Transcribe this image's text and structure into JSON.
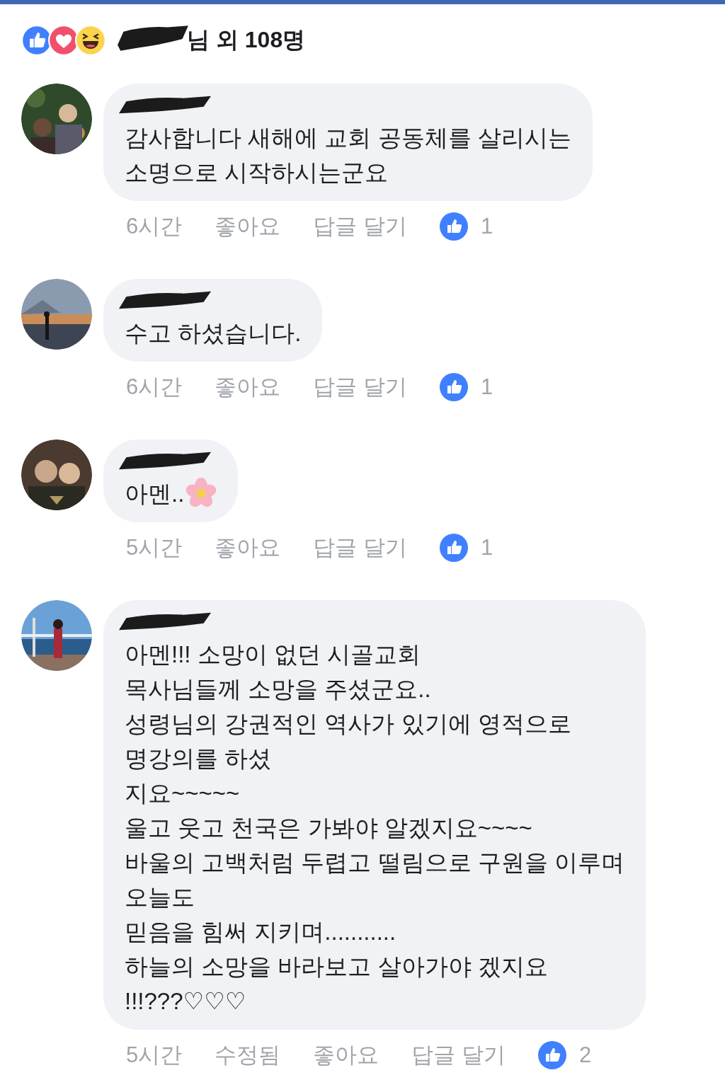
{
  "reactions": {
    "icons": [
      {
        "kind": "like"
      },
      {
        "kind": "love"
      },
      {
        "kind": "haha"
      }
    ],
    "name_redacted": true,
    "summary": "님 외 108명"
  },
  "comments": [
    {
      "name_redacted": true,
      "lines": [
        "감사합니다 새해에 교회 공동체를 살리시는",
        "소명으로 시작하시는군요"
      ],
      "meta": [
        "6시간",
        "좋아요",
        "답글 달기"
      ],
      "like_count": "1"
    },
    {
      "name_redacted": true,
      "lines": [
        "수고 하셨습니다."
      ],
      "meta": [
        "6시간",
        "좋아요",
        "답글 달기"
      ],
      "like_count": "1"
    },
    {
      "name_redacted": true,
      "lines": [
        "아멘.."
      ],
      "emoji": {
        "kind": "flower"
      },
      "meta": [
        "5시간",
        "좋아요",
        "답글 달기"
      ],
      "like_count": "1"
    },
    {
      "name_redacted": true,
      "lines": [
        "아멘!!! 소망이 없던 시골교회",
        "목사님들께 소망을 주셨군요..",
        "성령님의 강권적인 역사가 있기에 영적으로",
        "명강의를 하셨",
        "지요~~~~~",
        "울고 웃고 천국은 가봐야 알겠지요~~~~",
        "바울의 고백처럼 두렵고 떨림으로 구원을 이루며",
        "오늘도",
        "믿음을 힘써 지키며...........",
        "하늘의 소망을 바라보고 살아가야  겠지요",
        "!!!???♡♡♡"
      ],
      "meta": [
        "5시간",
        "수정됨",
        "좋아요",
        "답글 달기"
      ],
      "like_count": "2"
    }
  ]
}
